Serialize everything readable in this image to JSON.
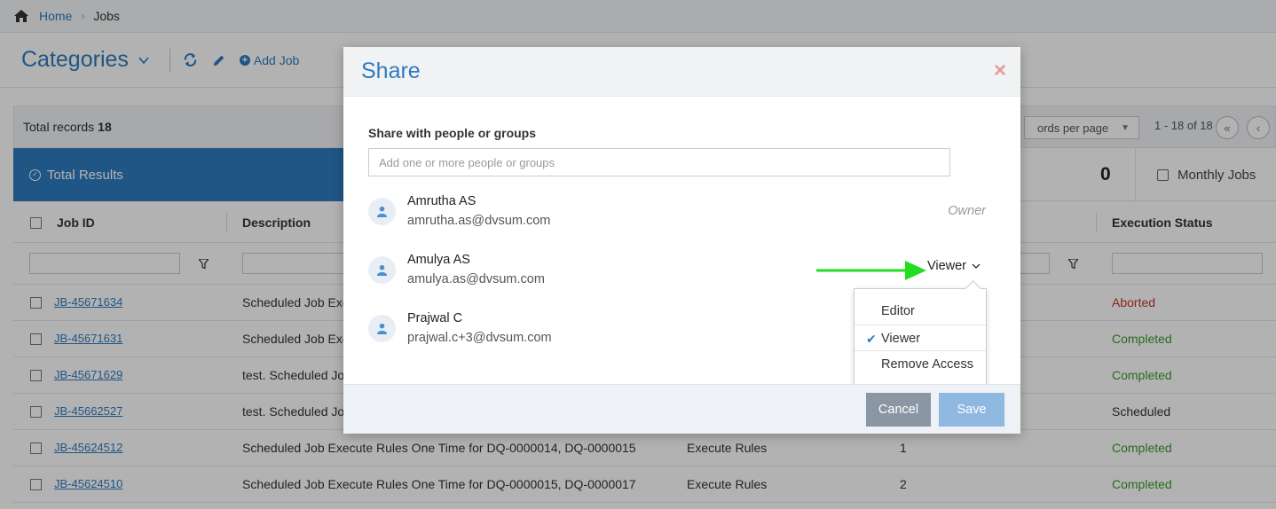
{
  "breadcrumb": {
    "home": "Home",
    "current": "Jobs"
  },
  "header": {
    "title": "Categories",
    "add_job": "Add Job"
  },
  "records": {
    "label": "Total records",
    "count": "18",
    "per_page": "ords per page",
    "range": "1 - 18 of 18"
  },
  "results": {
    "total_results": "Total Results",
    "count": "0",
    "monthly_jobs": "Monthly Jobs"
  },
  "table": {
    "columns": {
      "job_id": "Job ID",
      "description": "Description",
      "execution_status": "Execution Status"
    },
    "rows": [
      {
        "job_id": "JB-45671634",
        "description": "Scheduled Job Exec",
        "type": "",
        "count": "",
        "status": "Aborted"
      },
      {
        "job_id": "JB-45671631",
        "description": "Scheduled Job Exec",
        "type": "",
        "count": "",
        "status": "Completed"
      },
      {
        "job_id": "JB-45671629",
        "description": "test. Scheduled Job",
        "type": "",
        "count": "",
        "status": "Completed"
      },
      {
        "job_id": "JB-45662527",
        "description": "test. Scheduled Job",
        "type": "",
        "count": "",
        "status": "Scheduled"
      },
      {
        "job_id": "JB-45624512",
        "description": "Scheduled Job Execute Rules One Time for DQ-0000014, DQ-0000015",
        "type": "Execute Rules",
        "count": "1",
        "status": "Completed"
      },
      {
        "job_id": "JB-45624510",
        "description": "Scheduled Job Execute Rules One Time for DQ-0000015, DQ-0000017",
        "type": "Execute Rules",
        "count": "2",
        "status": "Completed"
      }
    ]
  },
  "modal": {
    "title": "Share",
    "close": "×",
    "share_label": "Share with people or groups",
    "share_placeholder": "Add one or more people or groups",
    "people": [
      {
        "name": "Amrutha AS",
        "email": "amrutha.as@dvsum.com",
        "role": "Owner"
      },
      {
        "name": "Amulya AS",
        "email": "amulya.as@dvsum.com",
        "role": "Viewer"
      },
      {
        "name": "Prajwal C",
        "email": "prajwal.c+3@dvsum.com",
        "role": ""
      }
    ],
    "dropdown": {
      "editor": "Editor",
      "viewer": "Viewer",
      "remove": "Remove Access",
      "check": "✔"
    },
    "cancel": "Cancel",
    "save": "Save"
  },
  "colors": {
    "accent": "#2f7bbf",
    "arrow": "#22dd22",
    "aborted": "#c0392b",
    "completed": "#3c9a2e"
  },
  "icons": [
    "home-icon",
    "chevron-right-icon",
    "chevron-down-icon",
    "refresh-icon",
    "pencil-icon",
    "plus-circle-icon",
    "check-circle-icon",
    "calendar-icon",
    "filter-icon",
    "user-icon",
    "close-icon",
    "check-icon",
    "arrow-right-icon"
  ]
}
